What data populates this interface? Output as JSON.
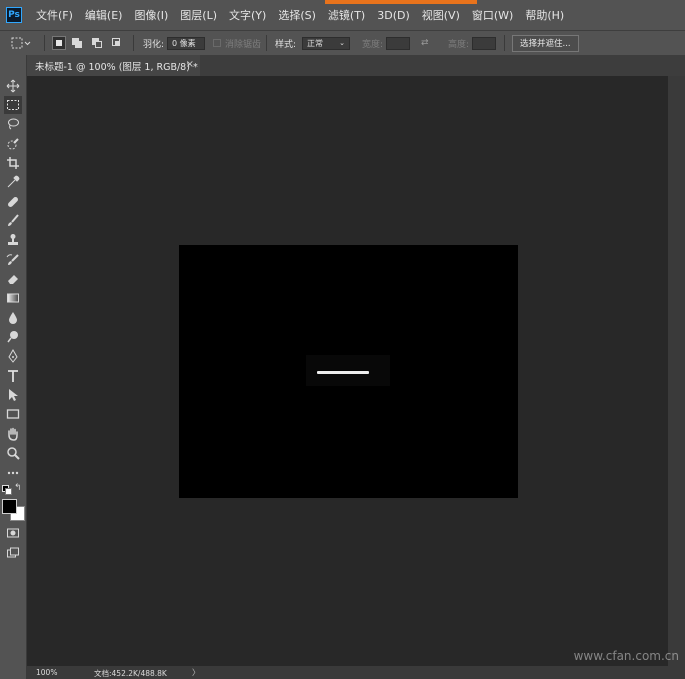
{
  "app": {
    "logo": "Ps"
  },
  "menu": [
    "文件(F)",
    "编辑(E)",
    "图像(I)",
    "图层(L)",
    "文字(Y)",
    "选择(S)",
    "滤镜(T)",
    "3D(D)",
    "视图(V)",
    "窗口(W)",
    "帮助(H)"
  ],
  "options": {
    "feather_label": "羽化:",
    "feather_value": "0 像素",
    "antialias_label": "消除锯齿",
    "style_label": "样式:",
    "style_value": "正常",
    "width_label": "宽度:",
    "height_label": "高度:",
    "select_mask_button": "选择并遮住..."
  },
  "document": {
    "tab_title": "未标题-1 @ 100% (图层 1, RGB/8) *",
    "close_glyph": "×"
  },
  "status": {
    "zoom": "100%",
    "doc_info": "文档:452.2K/488.8K",
    "arrow": "〉"
  },
  "watermark": "www.cfan.com.cn",
  "colors": {
    "accent": "#e8731c",
    "foreground": "#000000",
    "background": "#ffffff",
    "ui_panel": "#535353",
    "workspace": "#282828"
  },
  "tools": [
    "move-icon",
    "marquee-icon",
    "lasso-icon",
    "quick-select-icon",
    "crop-icon",
    "eyedropper-icon",
    "healing-icon",
    "brush-icon",
    "stamp-icon",
    "history-brush-icon",
    "eraser-icon",
    "gradient-icon",
    "blur-icon",
    "dodge-icon",
    "pen-icon",
    "type-icon",
    "path-select-icon",
    "rectangle-icon",
    "hand-icon",
    "zoom-icon",
    "more-icon",
    "quickmask-icon",
    "screen-mode-icon"
  ]
}
